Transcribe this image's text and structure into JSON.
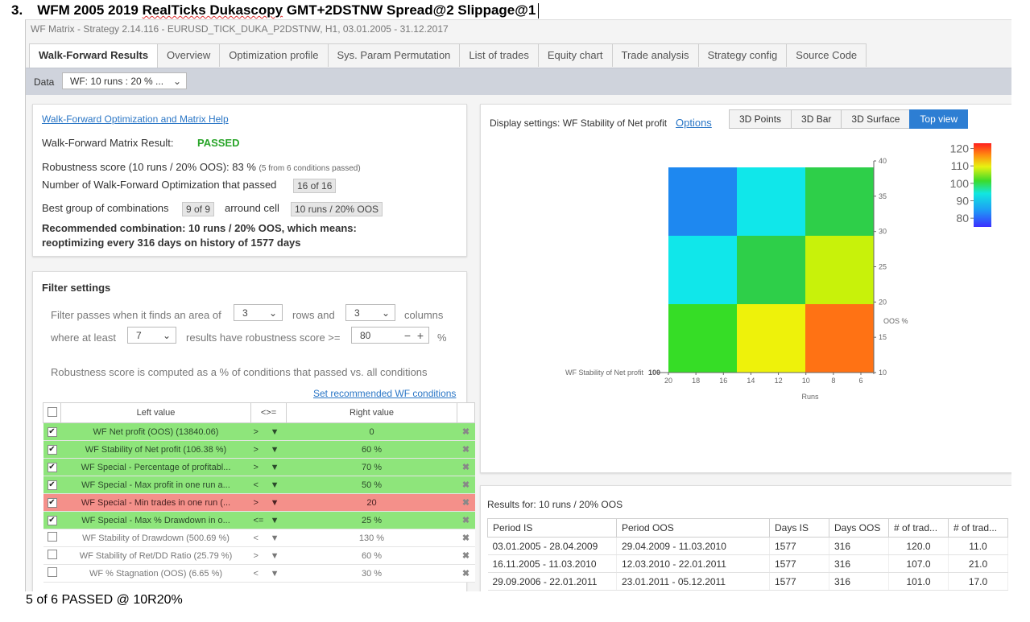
{
  "heading": {
    "number": "3.",
    "prefix": "WFM 2005 2019 ",
    "wavy_part": "RealTicks Dukascopy",
    "suffix": " GMT+2DSTNW Spread@2 Slippage@1"
  },
  "footer": "5 of 6 PASSED @ 10R20%",
  "window": {
    "title": "WF Matrix - Strategy 2.14.116 - EURUSD_TICK_DUKA_P2DSTNW, H1, 03.01.2005 - 31.12.2017"
  },
  "tabs": [
    {
      "label": "Walk-Forward Results",
      "active": true
    },
    {
      "label": "Overview"
    },
    {
      "label": "Optimization profile"
    },
    {
      "label": "Sys. Param Permutation"
    },
    {
      "label": "List of trades"
    },
    {
      "label": "Equity chart"
    },
    {
      "label": "Trade analysis"
    },
    {
      "label": "Strategy config"
    },
    {
      "label": "Source Code"
    }
  ],
  "databar": {
    "label": "Data",
    "selected": "WF: 10 runs : 20 % ..."
  },
  "wf_result": {
    "help_link": "Walk-Forward Optimization and Matrix Help",
    "matrix_result_label": "Walk-Forward Matrix Result:",
    "matrix_result_value": "PASSED",
    "robustness_text": "Robustness score (10 runs / 20% OOS): 83 %",
    "robustness_note": "(5 from 6 conditions passed)",
    "passed_label": "Number of Walk-Forward Optimization that passed",
    "passed_value": "16 of 16",
    "best_group_label": "Best group of combinations",
    "best_group_value": "9 of 9",
    "around_label": "arround cell",
    "around_value": "10 runs / 20% OOS",
    "recommended_line1": "Recommended combination: 10 runs / 20% OOS, which means:",
    "recommended_line2": "reoptimizing every 316 days on history of 1577 days"
  },
  "filter": {
    "title": "Filter settings",
    "line1_a": "Filter passes when it finds an area of",
    "rows_value": "3",
    "line1_b": "rows and",
    "cols_value": "3",
    "line1_c": "columns",
    "line2_a": "where at least",
    "atleast_value": "7",
    "line2_b": "results have robustness score >=",
    "score_value": "80",
    "score_unit": "%",
    "explain": "Robustness score is computed as a % of conditions that passed vs. all conditions",
    "set_link": "Set recommended WF conditions",
    "headers": {
      "left": "Left value",
      "op": "<>=",
      "right": "Right value"
    },
    "conditions": [
      {
        "checked": true,
        "status": "ok",
        "left": "WF Net profit (OOS) (13840.06)",
        "op": ">",
        "right": "0"
      },
      {
        "checked": true,
        "status": "ok",
        "left": "WF Stability of Net profit (106.38 %)",
        "op": ">",
        "right": "60 %"
      },
      {
        "checked": true,
        "status": "ok",
        "left": "WF Special - Percentage of profitabl...",
        "op": ">",
        "right": "70 %"
      },
      {
        "checked": true,
        "status": "ok",
        "left": "WF Special - Max profit in one run a...",
        "op": "<",
        "right": "50 %"
      },
      {
        "checked": true,
        "status": "bad",
        "left": "WF Special - Min trades in one run (...",
        "op": ">",
        "right": "20"
      },
      {
        "checked": true,
        "status": "ok",
        "left": "WF Special - Max % Drawdown in o...",
        "op": "<=",
        "right": "25 %"
      },
      {
        "checked": false,
        "status": "off",
        "left": "WF Stability of Drawdown (500.69 %)",
        "op": "<",
        "right": "130 %"
      },
      {
        "checked": false,
        "status": "off",
        "left": "WF Stability of Ret/DD Ratio (25.79 %)",
        "op": ">",
        "right": "60 %"
      },
      {
        "checked": false,
        "status": "off",
        "left": "WF % Stagnation (OOS) (6.65 %)",
        "op": "<",
        "right": "30 %"
      }
    ]
  },
  "view": {
    "display_label": "Display settings: WF Stability of Net profit",
    "options_link": "Options",
    "buttons": [
      {
        "label": "3D Points"
      },
      {
        "label": "3D Bar"
      },
      {
        "label": "3D Surface"
      },
      {
        "label": "Top view",
        "active": true
      }
    ]
  },
  "chart_data": {
    "type": "heatmap",
    "z_label": "WF Stability of Net profit",
    "z_axis_value": "100",
    "xlabel": "Runs",
    "ylabel": "OOS %",
    "x_ticks": [
      "20",
      "18",
      "16",
      "14",
      "12",
      "10",
      "8",
      "6"
    ],
    "y_ticks": [
      "10",
      "15",
      "20",
      "25",
      "30",
      "35",
      "40"
    ],
    "x_cells": [
      "15",
      "10",
      "5"
    ],
    "y_cells": [
      "35",
      "25",
      "15"
    ],
    "cells": [
      [
        {
          "value": 75,
          "color": "#1e88f0"
        },
        {
          "value": 88,
          "color": "#10e7ea"
        },
        {
          "value": 98,
          "color": "#2ecf49"
        }
      ],
      [
        {
          "value": 88,
          "color": "#10e7ea"
        },
        {
          "value": 98,
          "color": "#2ecf49"
        },
        {
          "value": 104,
          "color": "#c8f20a"
        }
      ],
      [
        {
          "value": 95,
          "color": "#36dd26"
        },
        {
          "value": 106,
          "color": "#eef20a"
        },
        {
          "value": 115,
          "color": "#ff7214"
        }
      ]
    ],
    "colorbar_ticks": [
      "120",
      "110",
      "100",
      "90",
      "80"
    ],
    "colorbar_range": [
      75,
      123
    ]
  },
  "results": {
    "title": "Results for: 10 runs / 20% OOS",
    "headers": [
      "Period IS",
      "Period OOS",
      "Days IS",
      "Days OOS",
      "# of trad...",
      "# of trad..."
    ],
    "rows": [
      [
        "03.01.2005 - 28.04.2009",
        "29.04.2009 - 11.03.2010",
        "1577",
        "316",
        "120.0",
        "11.0"
      ],
      [
        "16.11.2005 - 11.03.2010",
        "12.03.2010 - 22.01.2011",
        "1577",
        "316",
        "107.0",
        "21.0"
      ],
      [
        "29.09.2006 - 22.01.2011",
        "23.01.2011 - 05.12.2011",
        "1577",
        "316",
        "101.0",
        "17.0"
      ]
    ]
  }
}
